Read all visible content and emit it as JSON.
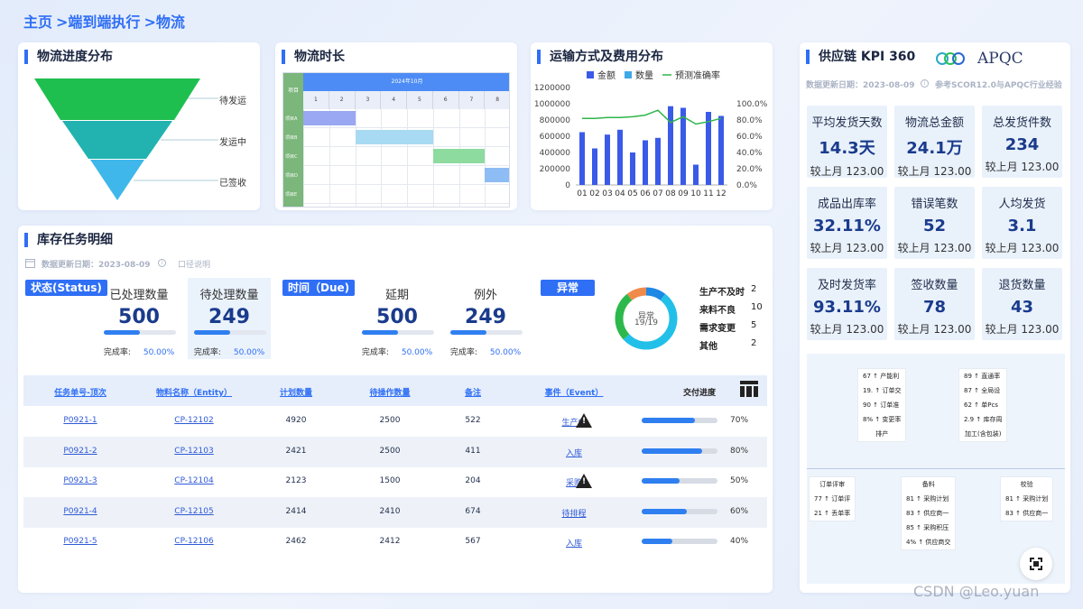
{
  "breadcrumb": [
    "主页",
    ">端到端执行",
    ">物流"
  ],
  "funnel": {
    "title": "物流进度分布",
    "labels": [
      "待发运",
      "发运中",
      "已签收"
    ],
    "colors": [
      "#1fbf4f",
      "#22b3b0",
      "#3fb7ea"
    ]
  },
  "gantt": {
    "title": "物流时长",
    "col_header": "项目",
    "month": "2024年10月",
    "days": [
      "1",
      "2",
      "3",
      "4",
      "5",
      "6",
      "7",
      "8"
    ],
    "items": [
      "项目A",
      "项目B",
      "项目C",
      "项目D",
      "项目E"
    ],
    "bars": [
      {
        "row": 0,
        "start": 1,
        "end": 3,
        "color": "#9aa7f2"
      },
      {
        "row": 1,
        "start": 3,
        "end": 6,
        "color": "#a8daf3"
      },
      {
        "row": 2,
        "start": 6,
        "end": 8,
        "color": "#8ddb9e"
      },
      {
        "row": 3,
        "start": 8,
        "end": 9,
        "color": "#8ebcf5"
      }
    ]
  },
  "chart_data": {
    "type": "bar",
    "title": "运输方式及费用分布",
    "categories": [
      "01",
      "02",
      "03",
      "04",
      "05",
      "06",
      "07",
      "08",
      "09",
      "10",
      "11",
      "12"
    ],
    "series": [
      {
        "name": "金额",
        "type": "bar",
        "values": [
          650000,
          450000,
          620000,
          680000,
          400000,
          550000,
          580000,
          970000,
          950000,
          250000,
          900000,
          850000
        ]
      },
      {
        "name": "数量",
        "type": "bar",
        "values": [
          0,
          0,
          0,
          0,
          0,
          0,
          0,
          0,
          0,
          0,
          0,
          0
        ]
      },
      {
        "name": "预测准确率",
        "type": "line",
        "axis": "right",
        "values": [
          82,
          82,
          83,
          83,
          84,
          86,
          92,
          77,
          84,
          75,
          78,
          82
        ]
      }
    ],
    "yticks_left": [
      "1200000",
      "1000000",
      "800000",
      "600000",
      "400000",
      "200000",
      "0"
    ],
    "yticks_right": [
      "100.0%",
      "80.0%",
      "60.0%",
      "40.0%",
      "20.0%",
      "0.0%"
    ],
    "ylim": [
      0,
      1200000
    ],
    "ylim_right": [
      0,
      100
    ],
    "colors": {
      "bar": "#3a5ae8",
      "qty": "#3fa8e8",
      "line": "#2fb54a"
    },
    "legend_position": "top"
  },
  "kpi": {
    "title": "供应链 KPI 360",
    "logo_text": "APQC",
    "update": "数据更新日期：2023-08-09",
    "note": "参考SCOR12.0与APQC行业经验",
    "items": [
      {
        "name": "平均发货天数",
        "value": "14.3天",
        "sub": "较上月 123.00"
      },
      {
        "name": "物流总金额",
        "value": "24.1万",
        "sub": "较上月 123.00"
      },
      {
        "name": "总发货件数",
        "value": "234",
        "sub": "较上月 123.00"
      },
      {
        "name": "成品出库率",
        "value": "32.11%",
        "sub": "较上月 123.00"
      },
      {
        "name": "错误笔数",
        "value": "52",
        "sub": "较上月 123.00"
      },
      {
        "name": "人均发货",
        "value": "3.1",
        "sub": "较上月 123.00"
      },
      {
        "name": "及时发货率",
        "value": "93.11%",
        "sub": "较上月 123.00"
      },
      {
        "name": "签收数量",
        "value": "78",
        "sub": "较上月 123.00"
      },
      {
        "name": "退货数量",
        "value": "43",
        "sub": "较上月 123.00"
      }
    ]
  },
  "fishbone": {
    "top": [
      {
        "lines": [
          "67 ↑ 产能利",
          "19. ↑ 订单交",
          "90 ↑ 订单准",
          "8% ↑ 变更率"
        ],
        "footer": "排产"
      },
      {
        "lines": [
          "89 ↑ 直通率",
          "87 ↑ 全局设",
          "62 ↑ 单Pcs",
          "2.9 ↑ 库存周"
        ],
        "footer": "加工(含包装)"
      }
    ],
    "bottom": [
      {
        "header": "订单评审",
        "lines": [
          "77 ↑ 订单评",
          "21 ↑ 丢单率"
        ]
      },
      {
        "header": "备料",
        "lines": [
          "81 ↑ 采购计划",
          "83 ↑ 供应商一",
          "85 ↑ 采购积压",
          "4% ↑ 供应商交"
        ]
      },
      {
        "header": "校验",
        "lines": [
          "81 ↑ 采购计划",
          "83 ↑ 供应商一"
        ]
      }
    ]
  },
  "inventory": {
    "title": "库存任务明细",
    "update": "数据更新日期：2023-08-09",
    "caliber": "口径说明",
    "status_tag": "状态(Status)",
    "due_tag": "时间（Due)",
    "abnormal_tag": "异常",
    "stats": [
      {
        "name": "已处理数量",
        "value": "500",
        "rate_label": "完成率:",
        "rate": "50.00%",
        "pct": 50
      },
      {
        "name": "待处理数量",
        "value": "249",
        "rate_label": "完成率:",
        "rate": "50.00%",
        "pct": 50
      },
      {
        "name": "延期",
        "value": "500",
        "rate_label": "完成率:",
        "rate": "50.00%",
        "pct": 50
      },
      {
        "name": "例外",
        "value": "249",
        "rate_label": "完成率:",
        "rate": "50.00%",
        "pct": 50
      }
    ],
    "donut": {
      "label": "异常",
      "value": "19/19",
      "segments": [
        {
          "name": "生产不及时",
          "value": 2,
          "color": "#1e88e5"
        },
        {
          "name": "来料不良",
          "value": 10,
          "color": "#22c0e8"
        },
        {
          "name": "需求变更",
          "value": 5,
          "color": "#2db84c"
        },
        {
          "name": "其他",
          "value": 2,
          "color": "#f08a4b"
        }
      ]
    },
    "columns": [
      "任务单号-顶次",
      "物料名称（Entity）",
      "计划数量",
      "待操作数量",
      "备注",
      "事件（Event）",
      "交付进度"
    ],
    "rows": [
      {
        "id": "P0921-1",
        "entity": "CP-12102",
        "plan": "4920",
        "pending": "2500",
        "note": "522",
        "event": "生产中",
        "warn": true,
        "progress": 70,
        "ptext": "70%"
      },
      {
        "id": "P0921-2",
        "entity": "CP-12103",
        "plan": "2421",
        "pending": "2500",
        "note": "411",
        "event": "入库",
        "warn": false,
        "progress": 80,
        "ptext": "80%"
      },
      {
        "id": "P0921-3",
        "entity": "CP-12104",
        "plan": "2123",
        "pending": "1500",
        "note": "204",
        "event": "采购",
        "warn": true,
        "progress": 50,
        "ptext": "50%"
      },
      {
        "id": "P0921-4",
        "entity": "CP-12105",
        "plan": "2414",
        "pending": "2410",
        "note": "674",
        "event": "待排程",
        "warn": false,
        "progress": 60,
        "ptext": "60%"
      },
      {
        "id": "P0921-5",
        "entity": "CP-12106",
        "plan": "2462",
        "pending": "2412",
        "note": "567",
        "event": "入库",
        "warn": false,
        "progress": 40,
        "ptext": "40%"
      }
    ]
  },
  "watermark": "CSDN @Leo.yuan"
}
